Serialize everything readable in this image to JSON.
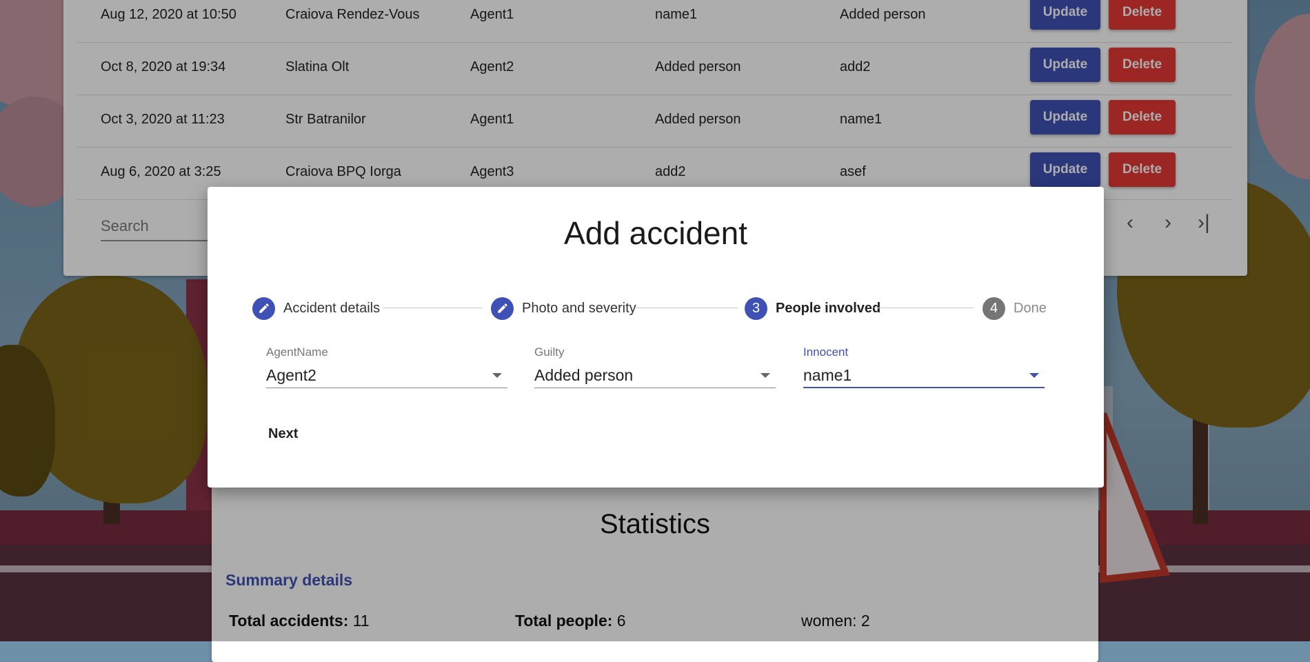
{
  "table": {
    "rows": [
      {
        "date": "Aug 12, 2020 at 10:50",
        "location": "Craiova Rendez-Vous",
        "agent": "Agent1",
        "guilty": "name1",
        "innocent": "Added person"
      },
      {
        "date": "Oct 8, 2020 at 19:34",
        "location": "Slatina Olt",
        "agent": "Agent2",
        "guilty": "Added person",
        "innocent": "add2"
      },
      {
        "date": "Oct 3, 2020 at 11:23",
        "location": "Str Batranilor",
        "agent": "Agent1",
        "guilty": "Added person",
        "innocent": "name1"
      },
      {
        "date": "Aug 6, 2020 at 3:25",
        "location": "Craiova BPQ Iorga",
        "agent": "Agent3",
        "guilty": "add2",
        "innocent": "asef"
      }
    ],
    "update_label": "Update",
    "delete_label": "Delete",
    "search_placeholder": "Search",
    "pager": {
      "prev": "‹",
      "next": "›",
      "last": "›|"
    }
  },
  "modal": {
    "title": "Add accident",
    "steps": [
      {
        "label": "Accident details",
        "icon": "pencil-icon",
        "state": "completed"
      },
      {
        "label": "Photo and severity",
        "icon": "pencil-icon",
        "state": "completed"
      },
      {
        "label": "People involved",
        "number": "3",
        "state": "active"
      },
      {
        "label": "Done",
        "number": "4",
        "state": "pending"
      }
    ],
    "fields": [
      {
        "label": "AgentName",
        "value": "Agent2"
      },
      {
        "label": "Guilty",
        "value": "Added person"
      },
      {
        "label": "Innocent",
        "value": "name1"
      }
    ],
    "next_label": "Next"
  },
  "stats": {
    "title": "Statistics",
    "summary_label": "Summary details",
    "total_accidents_label": "Total accidents:",
    "total_accidents_value": "11",
    "total_people_label": "Total people:",
    "total_people_value": "6",
    "women_text": "women: 2"
  },
  "colors": {
    "primary": "#3f51b5",
    "danger": "#e53935"
  }
}
